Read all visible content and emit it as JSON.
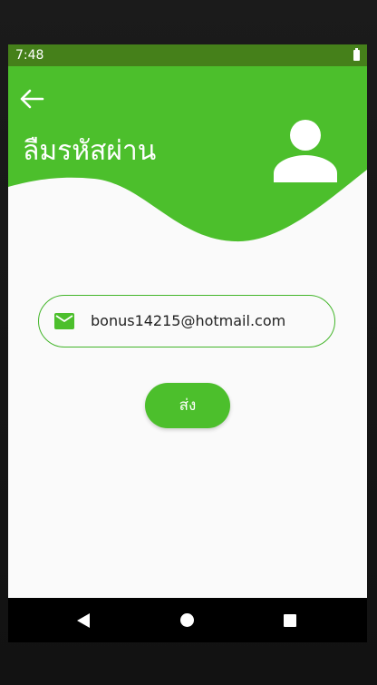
{
  "status_bar": {
    "time": "7:48",
    "battery_icon": "battery-full-icon"
  },
  "header": {
    "title": "ลืมรหัสผ่าน",
    "back_icon": "arrow-left-icon",
    "avatar_icon": "person-icon",
    "background_color": "#4cbf2c"
  },
  "form": {
    "email_icon": "envelope-icon",
    "email_value": "bonus14215@hotmail.com",
    "accent_color": "#4cbf2c"
  },
  "send_button": {
    "label": "ส่ง"
  },
  "nav_bar": {
    "back_icon": "triangle-back-icon",
    "home_icon": "circle-home-icon",
    "recents_icon": "square-recents-icon"
  }
}
